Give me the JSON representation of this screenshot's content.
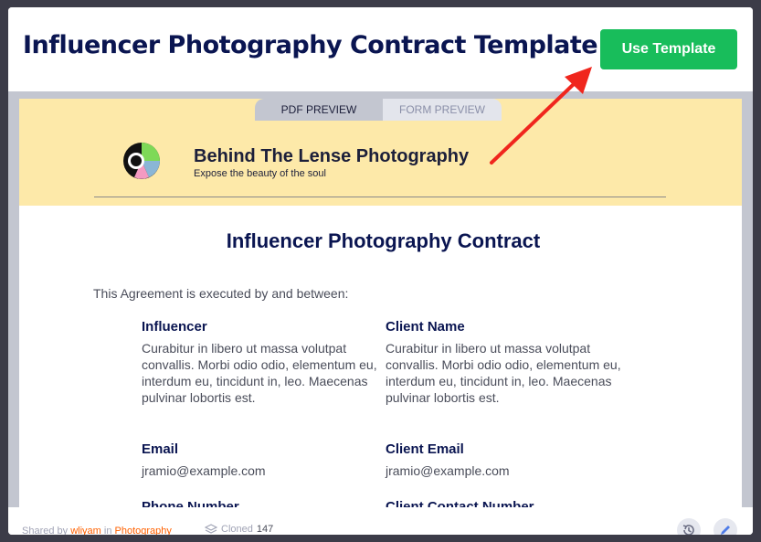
{
  "modal": {
    "title": "Influencer Photography Contract Template",
    "use_button": "Use Template"
  },
  "tabs": [
    {
      "label": "PDF PREVIEW",
      "active": true
    },
    {
      "label": "FORM PREVIEW",
      "active": false
    }
  ],
  "document": {
    "company_name": "Behind The Lense Photography",
    "company_tagline": "Expose the beauty of the soul",
    "title": "Influencer Photography Contract",
    "intro": "This Agreement is executed by and between:",
    "fields": [
      {
        "label": "Influencer",
        "value": "Curabitur in libero ut massa volutpat convallis. Morbi odio odio, elementum eu, interdum eu, tincidunt in, leo. Maecenas pulvinar lobortis est."
      },
      {
        "label": "Client Name",
        "value": "Curabitur in libero ut massa volutpat convallis. Morbi odio odio, elementum eu, interdum eu, tincidunt in, leo. Maecenas pulvinar lobortis est."
      },
      {
        "label": "Email",
        "value": "jramio@example.com"
      },
      {
        "label": "Client Email",
        "value": "jramio@example.com"
      },
      {
        "label": "Phone Number",
        "value": ""
      },
      {
        "label": "Client Contact Number",
        "value": ""
      }
    ]
  },
  "footer": {
    "shared_by_prefix": "Shared by",
    "user": "wliyam",
    "in_word": "in",
    "category": "Photography",
    "cloned_label": "Cloned",
    "cloned_count": "147"
  },
  "colors": {
    "accent_green": "#18bd5b",
    "navy": "#0a1551",
    "header_yellow": "#fde9a9",
    "link_orange": "#ff6100",
    "annotation_arrow": "#f0261d"
  },
  "icons": {
    "logo": "camera-aperture-logo",
    "cloned": "layers-icon",
    "history": "history-icon",
    "edit": "pencil-icon"
  }
}
